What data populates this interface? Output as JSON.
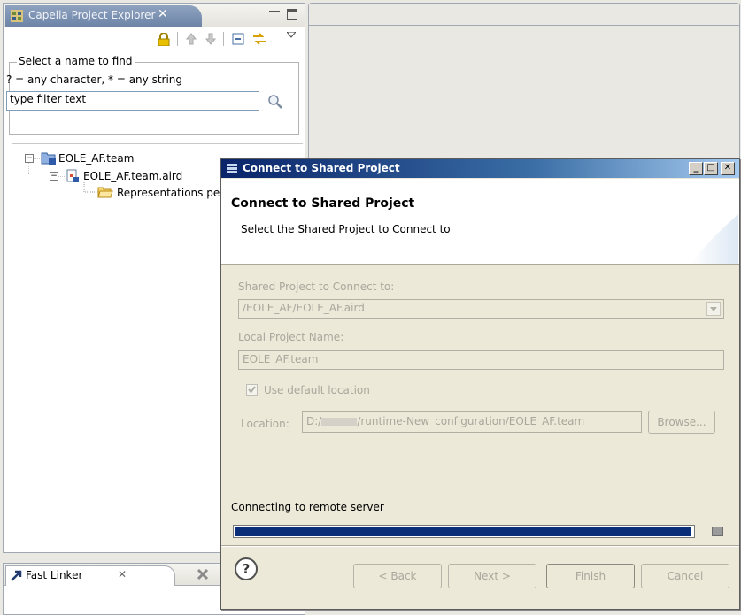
{
  "explorer": {
    "tab_title": "Capella Project Explorer",
    "tab_close": "✕",
    "filter": {
      "group_title": "Select a name to find",
      "hint": "? = any character, * = any string",
      "value": "type filter text"
    },
    "tree": {
      "project": "EOLE_AF.team",
      "aird": "EOLE_AF.team.aird",
      "folder": "Representations pe"
    }
  },
  "fast_linker": {
    "tab_title": "Fast Linker",
    "tab_close": "✕"
  },
  "dialog": {
    "window_title": "Connect to Shared Project",
    "heading": "Connect to Shared Project",
    "description": "Select the Shared Project to Connect to",
    "shared_project_label": "Shared Project to Connect to:",
    "shared_project_value": "/EOLE_AF/EOLE_AF.aird",
    "local_name_label": "Local Project Name:",
    "local_name_value": "EOLE_AF.team",
    "use_default_label": "Use default location",
    "location_label": "Location:",
    "location_prefix": "D:/",
    "location_suffix": "/runtime-New_configuration/EOLE_AF.team",
    "browse_label": "Browse...",
    "status_text": "Connecting to remote server",
    "progress": 0.995,
    "buttons": {
      "help": "?",
      "back": "< Back",
      "next": "Next >",
      "finish": "Finish",
      "cancel": "Cancel"
    }
  },
  "colors": {
    "titlebar_start": "#0a246a",
    "progress_fill": "#0b2e78",
    "tab_active": "#7b90b2"
  }
}
